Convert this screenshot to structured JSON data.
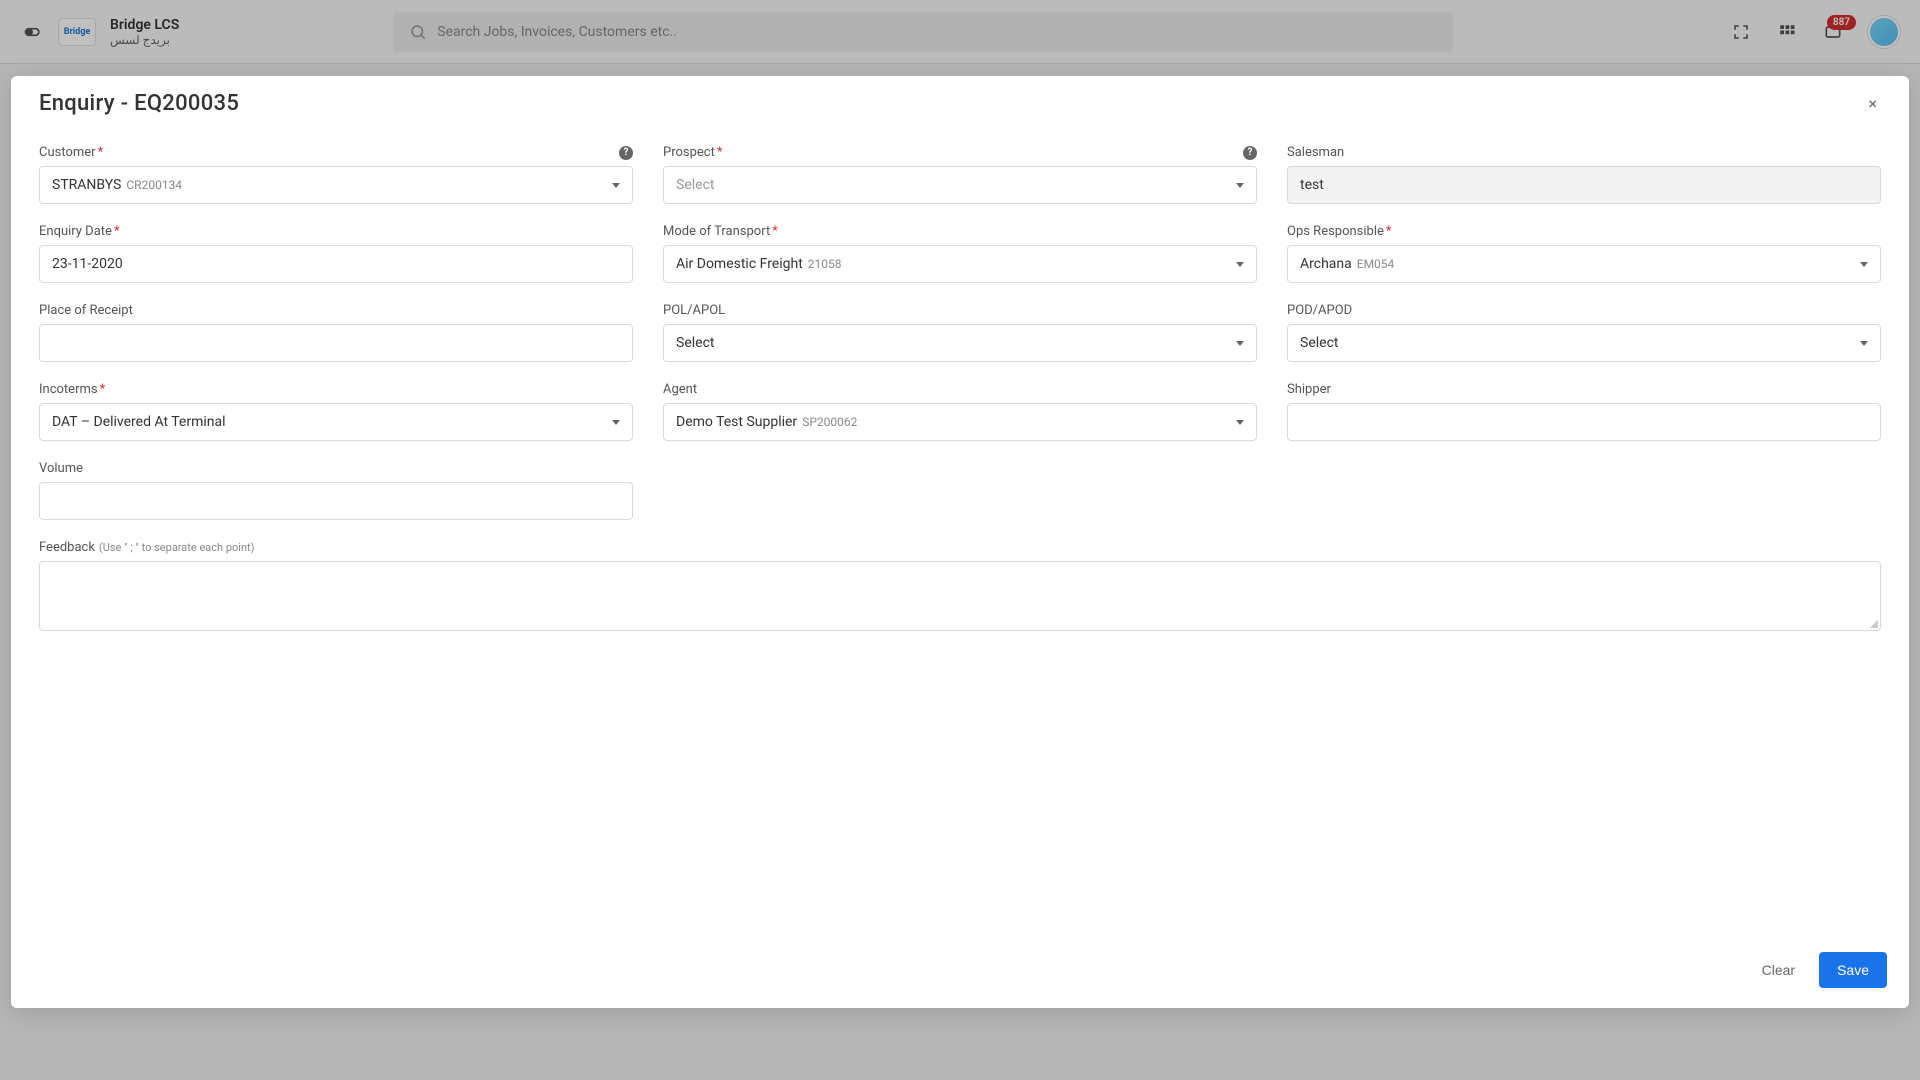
{
  "header": {
    "brand_name": "Bridge LCS",
    "brand_sub": "بريدج لسس",
    "brand_logo_text": "Bridge",
    "search_placeholder": "Search Jobs, Invoices, Customers etc..",
    "notification_count": "887"
  },
  "modal": {
    "title": "Enquiry - EQ200035",
    "close_label": "×",
    "clear_label": "Clear",
    "save_label": "Save"
  },
  "form": {
    "customer": {
      "label": "Customer",
      "value": "STRANBYS",
      "code": "CR200134"
    },
    "prospect": {
      "label": "Prospect",
      "placeholder": "Select"
    },
    "salesman": {
      "label": "Salesman",
      "value": "test"
    },
    "enquiry_date": {
      "label": "Enquiry Date",
      "value": "23-11-2020"
    },
    "mode_of_transport": {
      "label": "Mode of Transport",
      "value": "Air Domestic Freight",
      "code": "21058"
    },
    "ops_responsible": {
      "label": "Ops Responsible",
      "value": "Archana",
      "code": "EM054"
    },
    "place_of_receipt": {
      "label": "Place of Receipt",
      "value": ""
    },
    "pol_apol": {
      "label": "POL/APOL",
      "placeholder": "Select"
    },
    "pod_apod": {
      "label": "POD/APOD",
      "placeholder": "Select"
    },
    "incoterms": {
      "label": "Incoterms",
      "value": "DAT – Delivered At Terminal"
    },
    "agent": {
      "label": "Agent",
      "value": "Demo Test Supplier",
      "code": "SP200062"
    },
    "shipper": {
      "label": "Shipper",
      "value": ""
    },
    "volume": {
      "label": "Volume",
      "value": ""
    },
    "feedback": {
      "label": "Feedback",
      "hint": "(Use \" ; \" to separate each point)",
      "value": ""
    }
  }
}
